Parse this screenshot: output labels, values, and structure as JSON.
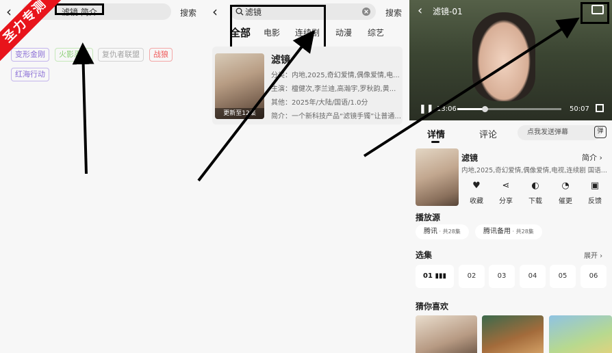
{
  "watermark": {
    "text": "圣力专测",
    "color": "#e8141b"
  },
  "panel1": {
    "back_glyph": "‹",
    "search_value": "滤镜 简介",
    "search_button": "搜索",
    "tags": [
      {
        "label": "变形金刚",
        "color": "#8b6fd6"
      },
      {
        "label": "火影忍者",
        "color": "#8fd07a"
      },
      {
        "label": "复仇者联盟",
        "color": "#a3a3a3"
      },
      {
        "label": "战狼",
        "color": "#ef5a5a"
      },
      {
        "label": "红海行动",
        "color": "#8b6fd6"
      }
    ]
  },
  "panel2": {
    "back_glyph": "‹",
    "search_icon": "search-icon",
    "search_value": "滤镜",
    "clear_icon": "close-circle-icon",
    "search_button": "搜索",
    "categories": [
      "全部",
      "电影",
      "连续剧",
      "动漫",
      "综艺"
    ],
    "result": {
      "title": "滤镜",
      "badge": "更新至12集",
      "genre": "分类：内地,2025,奇幻爱情,偶像爱情,电...",
      "cast": "主演：檀健次,李兰迪,高瀚宇,罗秋韵,黄...",
      "other": "其他：2025年/大陆/国语/1.0分",
      "summary": "简介：一个新科技产品“滤镜手镯”让普通..."
    }
  },
  "panel3": {
    "player": {
      "title": "滤镜-01",
      "current_time": "13:06",
      "total_time": "50:07",
      "progress": 0.26
    },
    "tabs": [
      "详情",
      "评论"
    ],
    "danmu_placeholder": "点我发送弹幕",
    "danmu_button": "弹",
    "detail": {
      "title": "滤镜",
      "intro_link": "简介 ›",
      "meta": "内地,2025,奇幻爱情,偶像爱情,电视,连续剧 国语..."
    },
    "actions": [
      {
        "icon": "heart-icon",
        "glyph": "♥",
        "label": "收藏"
      },
      {
        "icon": "share-icon",
        "glyph": "⋖",
        "label": "分享"
      },
      {
        "icon": "download-icon",
        "glyph": "◐",
        "label": "下载"
      },
      {
        "icon": "bell-icon",
        "glyph": "◔",
        "label": "催更"
      },
      {
        "icon": "feedback-icon",
        "glyph": "▣",
        "label": "反馈"
      }
    ],
    "source_section": "播放源",
    "sources": [
      {
        "name": "腾讯",
        "count": " · 共28集"
      },
      {
        "name": "腾讯备用",
        "count": " · 共28集"
      }
    ],
    "episodes_section": "选集",
    "expand_label": "展开 ›",
    "episodes": [
      "01 ▮▮▮",
      "02",
      "03",
      "04",
      "05",
      "06"
    ],
    "recommend_section": "猜你喜欢"
  }
}
